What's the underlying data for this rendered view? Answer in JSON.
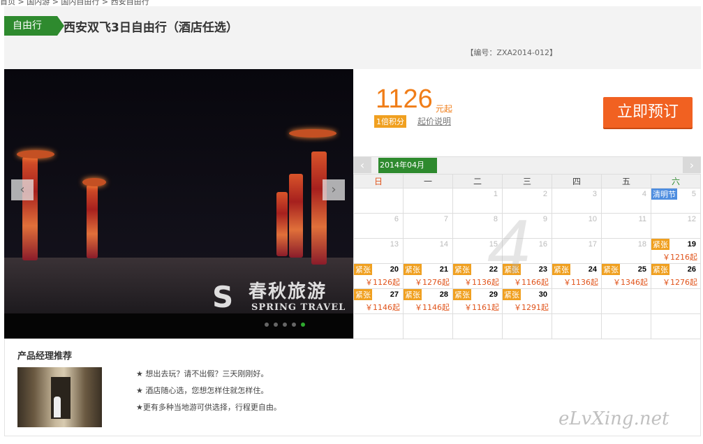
{
  "top": {
    "cut_text": "首页 > 国内游 > 国内自由行 > 西安自由行"
  },
  "header": {
    "tag": "自由行",
    "title": "西安双飞3日自由行（酒店任选）",
    "code": "【编号：ZXA2014-012】"
  },
  "photo": {
    "prev": "‹",
    "next": "›",
    "watermark_cn": "春秋旅游",
    "watermark_en": "SPRING TRAVEL",
    "slides": 5,
    "active_slide": 5
  },
  "price": {
    "value": "1126",
    "unit": "元起",
    "badge": "1倍积分",
    "explain": "起价说明",
    "book_button": "立即预订"
  },
  "calendar": {
    "month": "2014年04月",
    "weekdays": [
      "日",
      "一",
      "二",
      "三",
      "四",
      "五",
      "六"
    ],
    "weeks": [
      [
        {
          "d": ""
        },
        {
          "d": ""
        },
        {
          "d": "1"
        },
        {
          "d": "2"
        },
        {
          "d": "3"
        },
        {
          "d": "4"
        },
        {
          "d": "5",
          "holiday": "清明节"
        }
      ],
      [
        {
          "d": "6"
        },
        {
          "d": "7"
        },
        {
          "d": "8"
        },
        {
          "d": "9"
        },
        {
          "d": "10"
        },
        {
          "d": "11"
        },
        {
          "d": "12"
        }
      ],
      [
        {
          "d": "13"
        },
        {
          "d": "14"
        },
        {
          "d": "15"
        },
        {
          "d": "16"
        },
        {
          "d": "17"
        },
        {
          "d": "18"
        },
        {
          "d": "19",
          "status": "紧张",
          "price": "￥1216起"
        }
      ],
      [
        {
          "d": "20",
          "status": "紧张",
          "price": "￥1126起"
        },
        {
          "d": "21",
          "status": "紧张",
          "price": "￥1276起"
        },
        {
          "d": "22",
          "status": "紧张",
          "price": "￥1136起"
        },
        {
          "d": "23",
          "status": "紧张",
          "price": "￥1166起"
        },
        {
          "d": "24",
          "status": "紧张",
          "price": "￥1136起"
        },
        {
          "d": "25",
          "status": "紧张",
          "price": "￥1346起"
        },
        {
          "d": "26",
          "status": "紧张",
          "price": "￥1276起"
        }
      ],
      [
        {
          "d": "27",
          "status": "紧张",
          "price": "￥1146起"
        },
        {
          "d": "28",
          "status": "紧张",
          "price": "￥1146起"
        },
        {
          "d": "29",
          "status": "紧张",
          "price": "￥1161起"
        },
        {
          "d": "30",
          "status": "紧张",
          "price": "￥1291起"
        },
        {
          "d": ""
        },
        {
          "d": ""
        },
        {
          "d": ""
        }
      ],
      [
        {
          "d": ""
        },
        {
          "d": ""
        },
        {
          "d": ""
        },
        {
          "d": ""
        },
        {
          "d": ""
        },
        {
          "d": ""
        },
        {
          "d": ""
        }
      ]
    ],
    "big_watermark": "4"
  },
  "manager": {
    "title": "产品经理推荐",
    "points": [
      "★  想出去玩？请不出假？三天刚刚好。",
      "★  酒店随心选，您想怎样住就怎样住。",
      "★更有多种当地游可供选择，行程更自由。"
    ]
  },
  "signature": "eLvXing.net"
}
